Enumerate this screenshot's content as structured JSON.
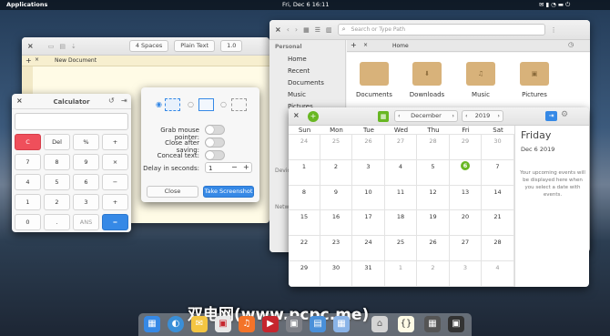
{
  "panel": {
    "apps": "Applications",
    "datetime": "Fri, Dec 6   16:11"
  },
  "editor": {
    "buttons": [
      "4 Spaces",
      "Plain Text",
      "1.0"
    ],
    "tab": "New Document"
  },
  "calculator": {
    "title": "Calculator",
    "keys": [
      "C",
      "Del",
      "%",
      "+",
      "7",
      "8",
      "9",
      "×",
      "4",
      "5",
      "6",
      "−",
      "1",
      "2",
      "3",
      "+",
      "0",
      ".",
      "ANS",
      "="
    ],
    "accent": "#ef4f5b",
    "equals_color": "#3689e6"
  },
  "screenshot": {
    "rows": [
      {
        "label": "Grab mouse pointer:"
      },
      {
        "label": "Close after saving:"
      },
      {
        "label": "Conceal text:"
      }
    ],
    "delay_label": "Delay in seconds:",
    "delay_value": "1",
    "close": "Close",
    "take": "Take Screenshot"
  },
  "files": {
    "search_placeholder": "Search or Type Path",
    "tab": "Home",
    "sidebar_heading": "Personal",
    "sidebar": [
      "Home",
      "Recent",
      "Documents",
      "Music",
      "Pictures"
    ],
    "section_devices": "Devic",
    "section_network": "Netw",
    "folders": [
      "Documents",
      "Downloads",
      "Music",
      "Pictures"
    ]
  },
  "calendar": {
    "month": "December",
    "year": "2019",
    "weekdays": [
      "Sun",
      "Mon",
      "Tue",
      "Wed",
      "Thu",
      "Fri",
      "Sat"
    ],
    "rows": [
      [
        "24",
        "25",
        "26",
        "27",
        "28",
        "29",
        "30"
      ],
      [
        "1",
        "2",
        "3",
        "4",
        "5",
        "6",
        "7"
      ],
      [
        "8",
        "9",
        "10",
        "11",
        "12",
        "13",
        "14"
      ],
      [
        "15",
        "16",
        "17",
        "18",
        "19",
        "20",
        "21"
      ],
      [
        "22",
        "23",
        "24",
        "25",
        "26",
        "27",
        "28"
      ],
      [
        "29",
        "30",
        "31",
        "1",
        "2",
        "3",
        "4"
      ]
    ],
    "today": "6",
    "today_color": "#68b723",
    "side_day": "Friday",
    "side_date": "Dec  6 2019",
    "side_msg": "Your upcoming events will be displayed here when you select a date with events."
  },
  "watermark": "双电网(www.pcpc.me)"
}
